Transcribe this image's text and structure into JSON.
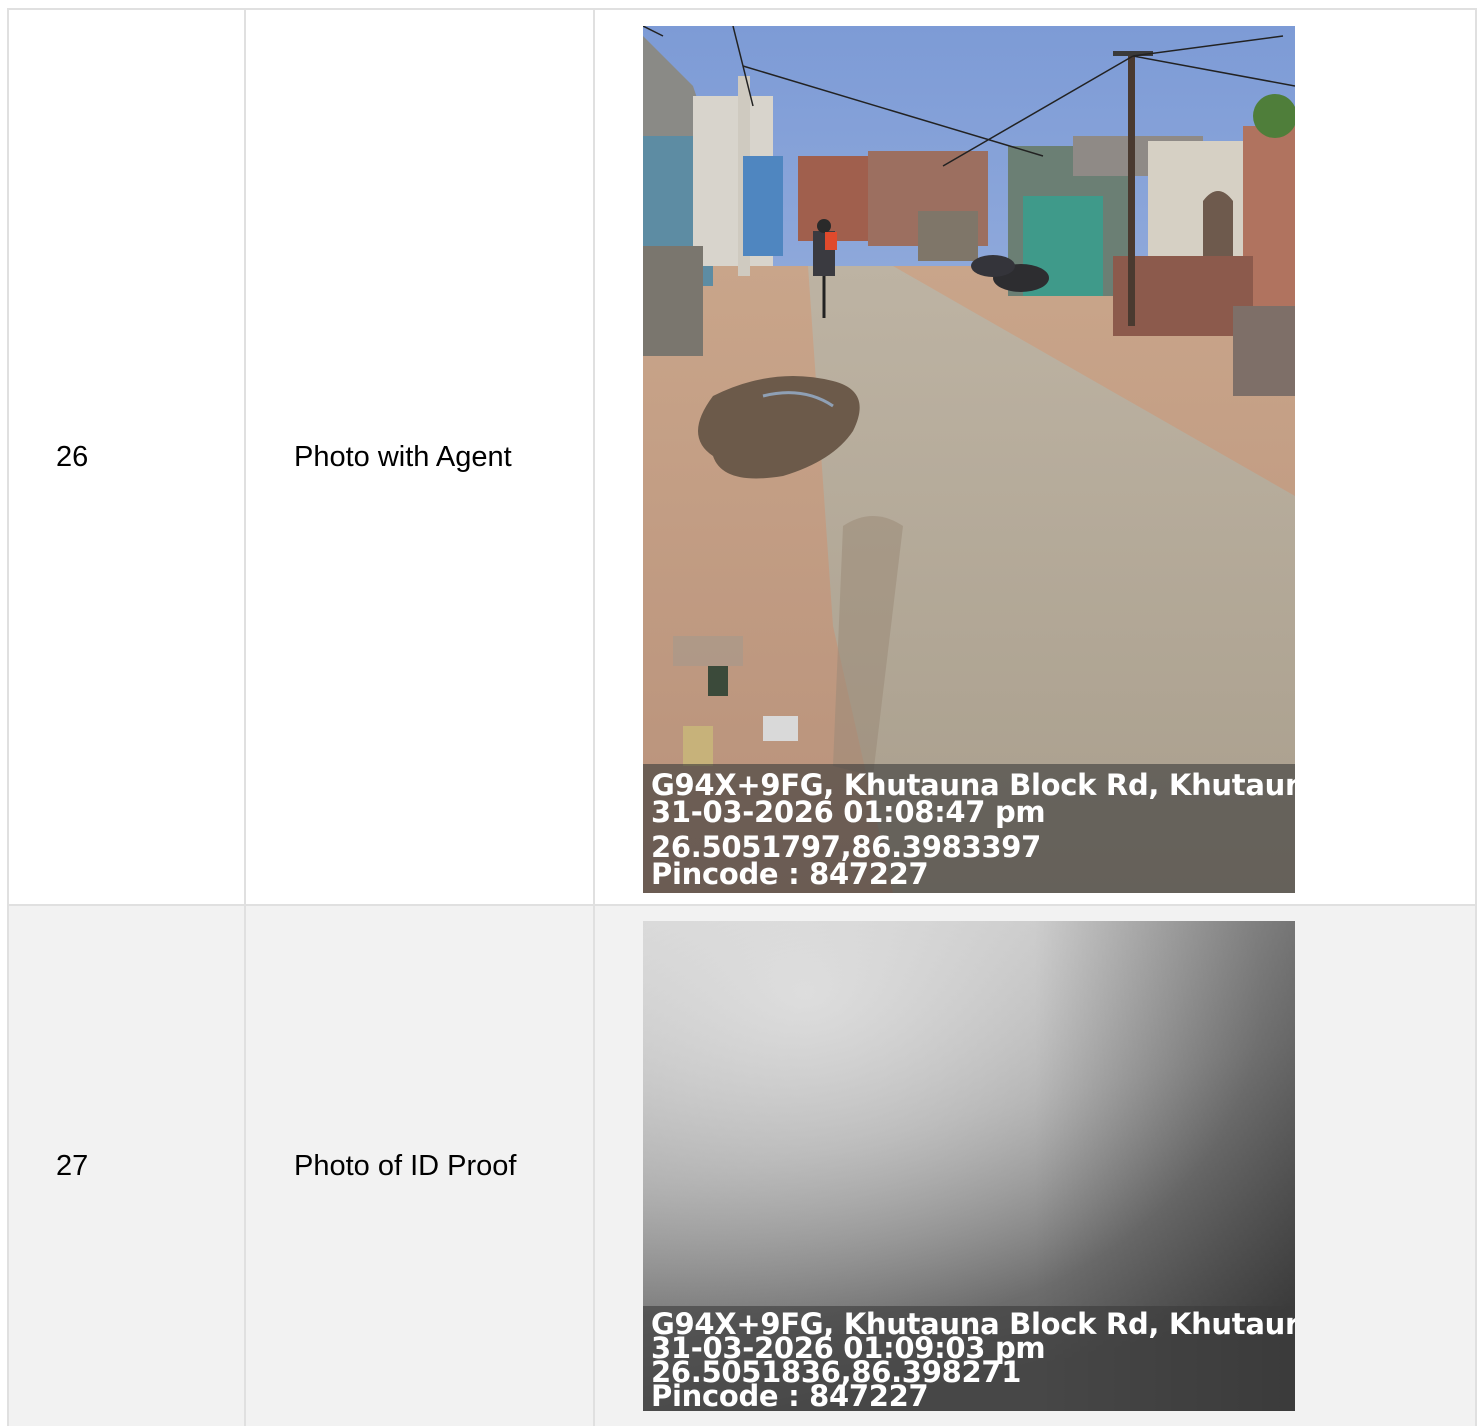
{
  "rows": [
    {
      "number": "26",
      "label": "Photo with Agent",
      "photo": {
        "icon": "street-photo",
        "stamp": {
          "address": "G94X+9FG, Khutauna Block Rd, Khutaun",
          "datetime": "31-03-2026 01:08:47 pm",
          "coords": "26.5051797,86.3983397",
          "pincode": "Pincode : 847227"
        }
      }
    },
    {
      "number": "27",
      "label": "Photo of ID Proof",
      "photo": {
        "icon": "blurry-photo",
        "stamp": {
          "address": "G94X+9FG, Khutauna Block Rd, Khutaur",
          "datetime": "31-03-2026 01:09:03 pm",
          "coords": "26.5051836,86.398271",
          "pincode": "Pincode : 847227"
        }
      }
    }
  ]
}
